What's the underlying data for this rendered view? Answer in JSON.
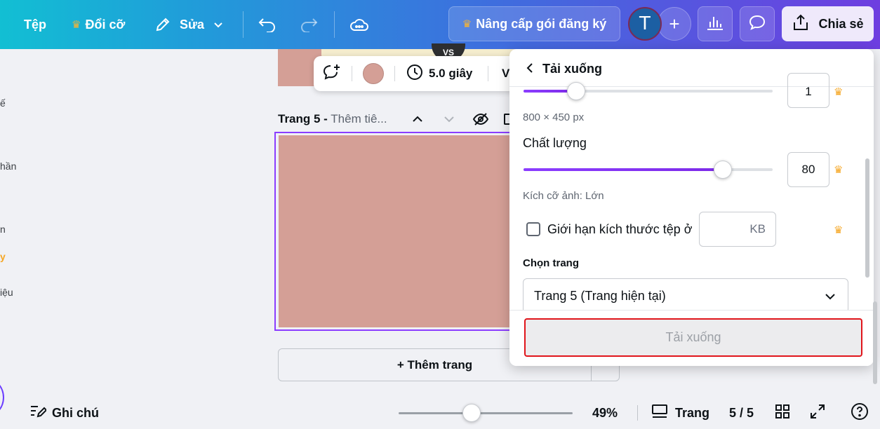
{
  "topbar": {
    "file_label": "Tệp",
    "resize_label": "Đổi cỡ",
    "edit_label": "Sửa",
    "upgrade_label": "Nâng cấp gói đăng ký",
    "avatar_letter": "T",
    "share_label": "Chia sẻ"
  },
  "sidebar_fragments": [
    "ế",
    "hần",
    "n",
    "y",
    "iệu"
  ],
  "canvas": {
    "vs_label": "VS",
    "duration_label": "5.0 giây",
    "toolbar_cutoff": "V",
    "page_title": "Trang 5 -",
    "page_subtitle": "Thêm tiê...",
    "add_page_label": "+ Thêm trang",
    "page_color": "#d49f96"
  },
  "download_panel": {
    "title": "Tải xuống",
    "size_value": "1",
    "dimensions": "800 × 450 px",
    "quality_label": "Chất lượng",
    "quality_value": "80",
    "quality_fraction": 0.8,
    "image_size_label": "Kích cỡ ảnh: Lớn",
    "limit_label": "Giới hạn kích thước tệp ở",
    "limit_unit": "KB",
    "limit_checked": false,
    "pages_heading": "Chọn trang",
    "pages_selected": "Trang 5 (Trang hiện tại)",
    "download_button": "Tải xuống"
  },
  "bottombar": {
    "notes_label": "Ghi chú",
    "zoom_value": "49%",
    "zoom_fraction": 0.42,
    "pages_label": "Trang",
    "page_count": "5 / 5"
  },
  "colors": {
    "accent": "#8b3dff",
    "crown": "#f5a623",
    "highlight_border": "#e0151b"
  }
}
